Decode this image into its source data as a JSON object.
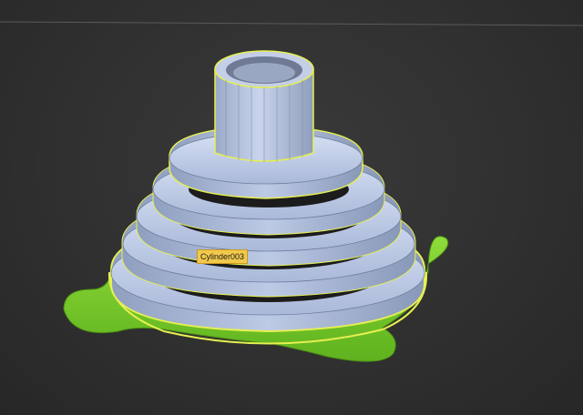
{
  "viewport": {
    "background_color": "#303030",
    "horizon_line_color": "#5a5a5a"
  },
  "scene": {
    "selected_object_label": "Cylinder003",
    "object_color": "#b4c3e0",
    "selection_outline_color": "#e6f050",
    "base_color": "#7ccf2e"
  }
}
